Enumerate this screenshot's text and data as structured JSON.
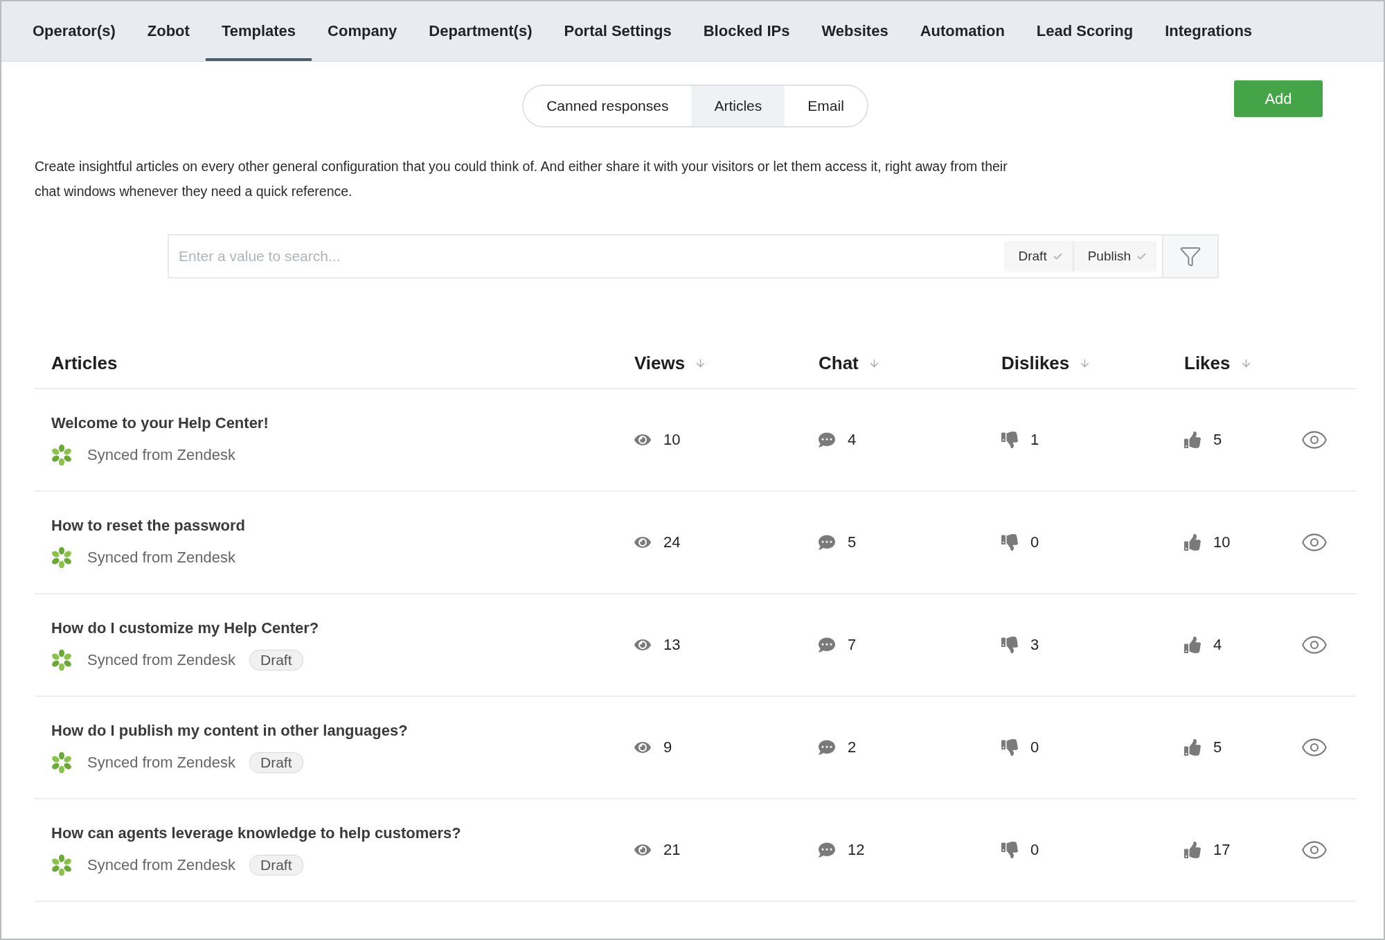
{
  "nav_tabs": [
    {
      "label": "Operator(s)",
      "selected": false
    },
    {
      "label": "Zobot",
      "selected": false
    },
    {
      "label": "Templates",
      "selected": true
    },
    {
      "label": "Company",
      "selected": false
    },
    {
      "label": "Department(s)",
      "selected": false
    },
    {
      "label": "Portal Settings",
      "selected": false
    },
    {
      "label": "Blocked IPs",
      "selected": false
    },
    {
      "label": "Websites",
      "selected": false
    },
    {
      "label": "Automation",
      "selected": false
    },
    {
      "label": "Lead Scoring",
      "selected": false
    },
    {
      "label": "Integrations",
      "selected": false
    }
  ],
  "segments": [
    {
      "label": "Canned responses",
      "selected": false
    },
    {
      "label": "Articles",
      "selected": true
    },
    {
      "label": "Email",
      "selected": false
    }
  ],
  "add_button": "Add",
  "description": "Create insightful articles on every other general configuration that you could think of. And either share it with your visitors or let them access it, right away from their chat windows whenever they need a quick reference.",
  "search": {
    "placeholder": "Enter a value to search...",
    "filters": [
      {
        "label": "Draft",
        "checked": true
      },
      {
        "label": "Publish",
        "checked": true
      }
    ]
  },
  "table": {
    "columns": [
      "Articles",
      "Views",
      "Chat",
      "Dislikes",
      "Likes"
    ],
    "rows": [
      {
        "title": "Welcome to your Help Center!",
        "source": "Synced from Zendesk",
        "views": "10",
        "chats": "4",
        "dislikes": "1",
        "likes": "5"
      },
      {
        "title": "How to reset the password",
        "source": "Synced from Zendesk",
        "views": "24",
        "chats": "5",
        "dislikes": "0",
        "likes": "10"
      },
      {
        "title": "How do I customize my Help Center?",
        "source": "Synced from Zendesk",
        "badge": "Draft",
        "views": "13",
        "chats": "7",
        "dislikes": "3",
        "likes": "4"
      },
      {
        "title": "How do I publish my content in other languages?",
        "source": "Synced from Zendesk",
        "badge": "Draft",
        "views": "9",
        "chats": "2",
        "dislikes": "0",
        "likes": "5"
      },
      {
        "title": "How can agents leverage knowledge to help customers?",
        "source": "Synced from Zendesk",
        "badge": "Draft",
        "views": "21",
        "chats": "12",
        "dislikes": "0",
        "likes": "17"
      }
    ]
  }
}
